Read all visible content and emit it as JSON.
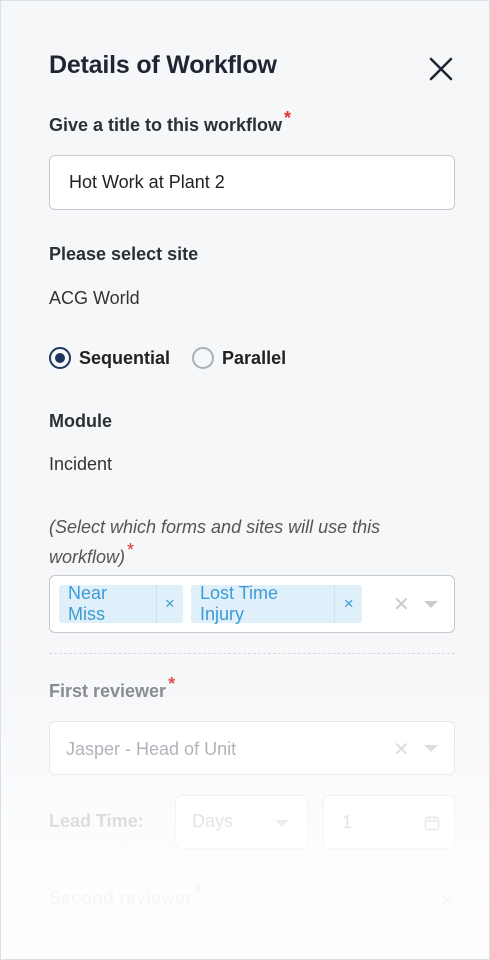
{
  "header": {
    "title": "Details of Workflow"
  },
  "title_field": {
    "label": "Give a title to this workflow",
    "required_mark": "*",
    "value": "Hot Work at Plant 2"
  },
  "site": {
    "label": "Please select site",
    "value": "ACG World"
  },
  "flow_type": {
    "options": [
      {
        "label": "Sequential",
        "selected": true
      },
      {
        "label": "Parallel",
        "selected": false
      }
    ]
  },
  "module": {
    "label": "Module",
    "value": "Incident"
  },
  "forms": {
    "hint": "(Select which forms and sites will use this workflow)",
    "required_mark": "*",
    "chips": [
      {
        "label": "Near Miss",
        "remove": "×"
      },
      {
        "label": "Lost Time Injury",
        "remove": "×"
      }
    ],
    "clear": "✕"
  },
  "first_reviewer": {
    "label": "First reviewer",
    "required_mark": "*",
    "value": "Jasper - Head of Unit",
    "clear": "✕"
  },
  "lead_time": {
    "label": "Lead Time:",
    "unit": "Days",
    "amount": "1"
  },
  "second_reviewer": {
    "label": "Second reviewer",
    "required_mark": "*",
    "remove": "✕"
  },
  "icons": {
    "close": "close-icon",
    "calendar": "calendar-icon"
  }
}
